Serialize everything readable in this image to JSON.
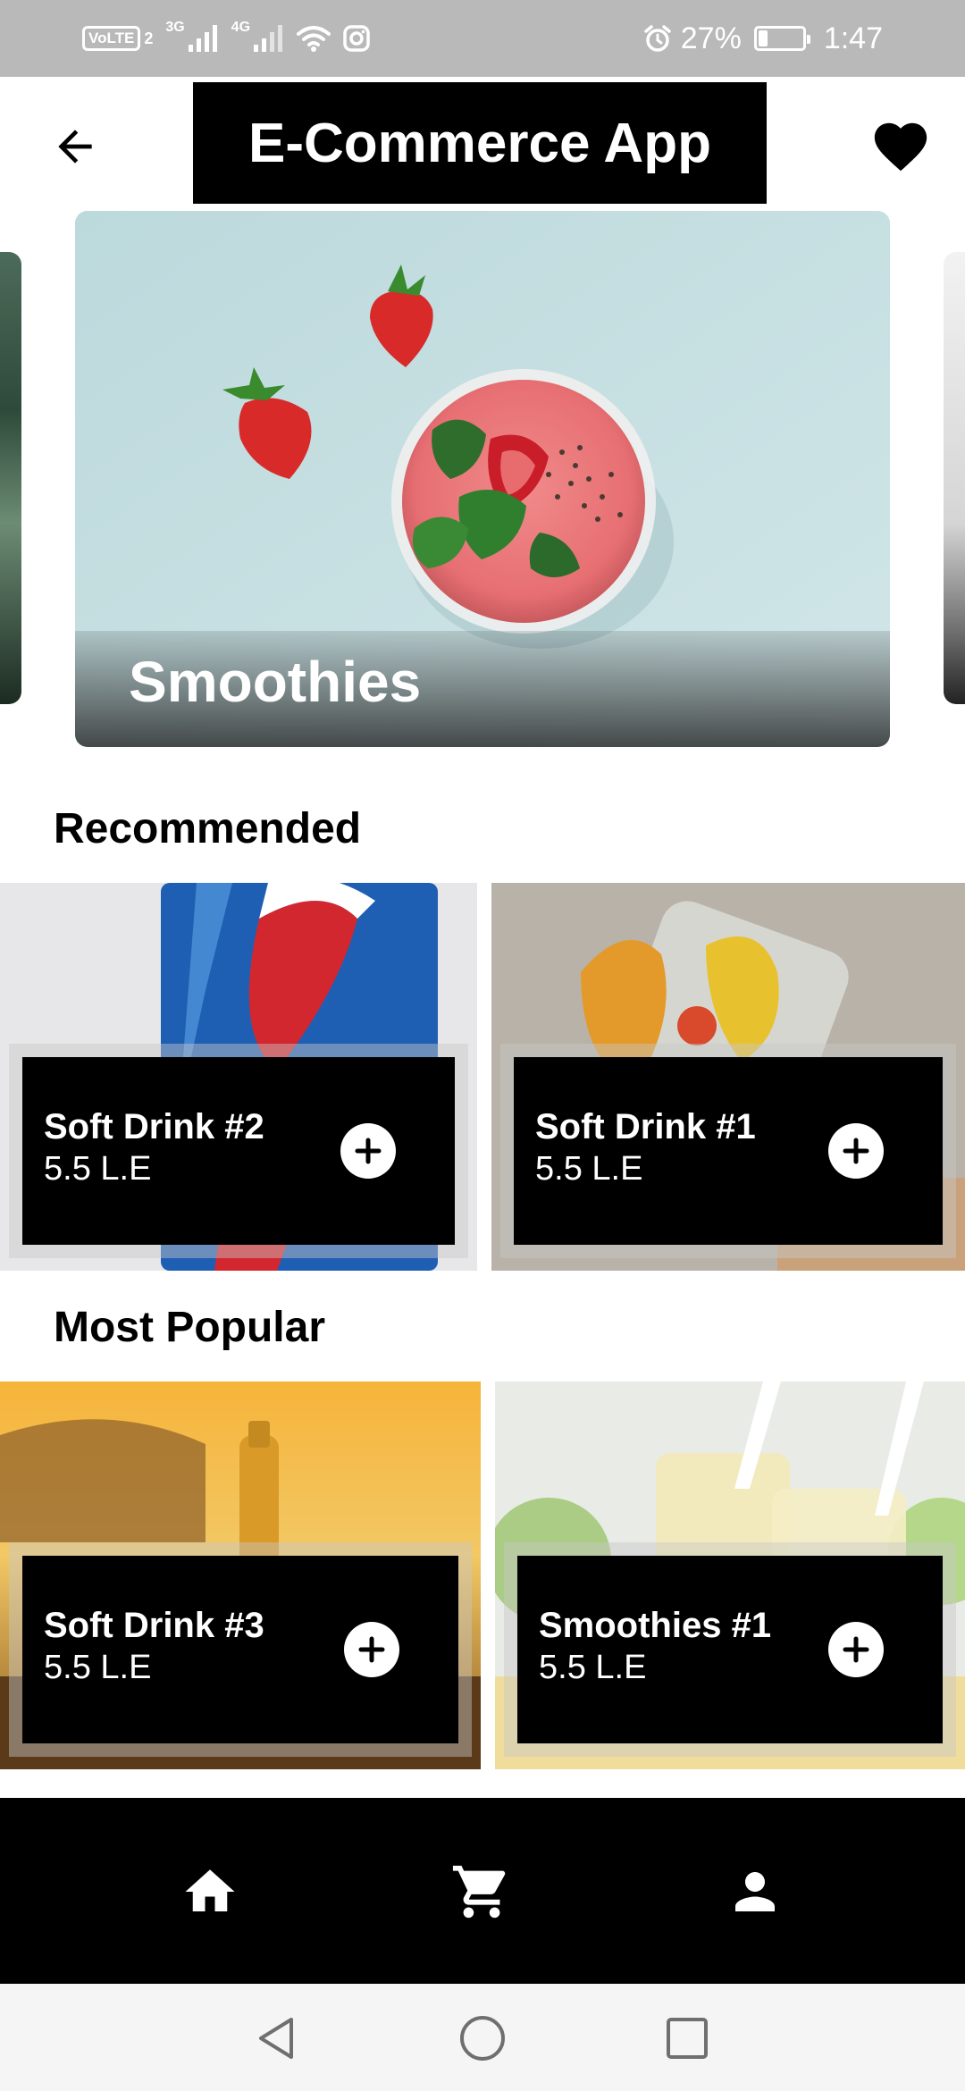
{
  "status_bar": {
    "volte": "VoLTE",
    "sim": "2",
    "net1": "3G",
    "net2": "4G",
    "battery_percent": "27%",
    "battery_level": 0.27,
    "time": "1:47",
    "icons": [
      "signal-icon",
      "wifi-icon",
      "instagram-icon",
      "alarm-icon",
      "battery-icon"
    ]
  },
  "app_bar": {
    "title": "E-Commerce App",
    "back_icon": "arrow-left-icon",
    "favorite_icon": "heart-icon"
  },
  "carousel": {
    "current_label": "Smoothies"
  },
  "recommended": {
    "title": "Recommended",
    "items": [
      {
        "name": "Soft Drink #2",
        "price": "5.5 L.E"
      },
      {
        "name": "Soft Drink #1",
        "price": "5.5 L.E"
      }
    ]
  },
  "most_popular": {
    "title": "Most Popular",
    "items": [
      {
        "name": "Soft Drink #3",
        "price": "5.5 L.E"
      },
      {
        "name": "Smoothies #1",
        "price": "5.5 L.E"
      }
    ]
  },
  "bottom_nav": {
    "items": [
      "home-icon",
      "cart-icon",
      "person-icon"
    ]
  },
  "system_nav": {
    "items": [
      "back-triangle-icon",
      "home-circle-icon",
      "recents-square-icon"
    ]
  },
  "colors": {
    "status_bar": "#b9b9b9",
    "primary": "#000000",
    "background": "#ffffff"
  }
}
